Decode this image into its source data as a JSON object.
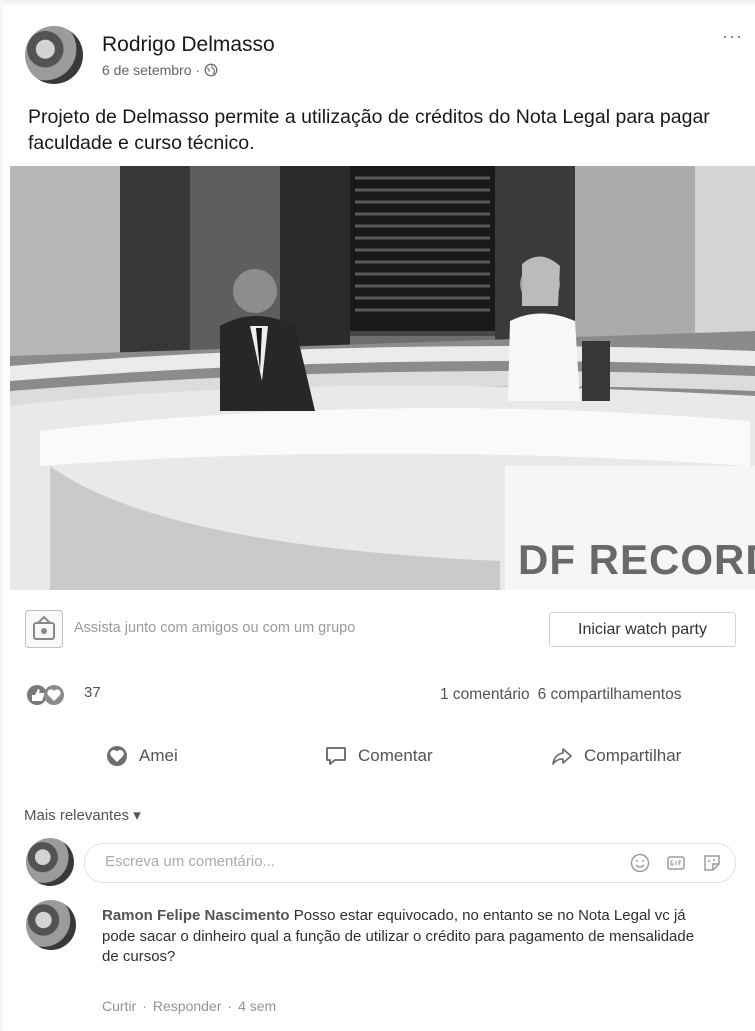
{
  "post": {
    "author": "Rodrigo Delmasso",
    "date": "6 de setembro",
    "separator": "·",
    "more_label": "···",
    "text": "Projeto de Delmasso permite a utilização de créditos do Nota Legal para pagar faculdade e curso técnico."
  },
  "video": {
    "channel_logo": "DF RECORD"
  },
  "watch_party": {
    "prompt": "Assista junto com amigos ou com um grupo",
    "button": "Iniciar watch party"
  },
  "stats": {
    "reactions_count": "37",
    "comments": "1 comentário",
    "shares": "6 compartilhamentos"
  },
  "actions": {
    "love": "Amei",
    "comment": "Comentar",
    "share": "Compartilhar"
  },
  "comments_section": {
    "sort_label": "Mais relevantes ▾",
    "composer_placeholder": "Escreva um comentário...",
    "items": [
      {
        "author": "Ramon Felipe Nascimento",
        "text": "Posso estar equivocado, no entanto se no Nota Legal vc já pode sacar o dinheiro qual a função de utilizar o crédito para pagamento de mensalidade de cursos?",
        "like": "Curtir",
        "reply": "Responder",
        "time": "4 sem",
        "dot": "·"
      }
    ]
  },
  "icons": {
    "globe": "globe-icon",
    "watch": "watch-party-icon",
    "love": "heart-icon",
    "comment": "comment-icon",
    "share": "share-icon",
    "emoji": "emoji-icon",
    "gif": "gif-icon",
    "sticker": "sticker-icon"
  }
}
